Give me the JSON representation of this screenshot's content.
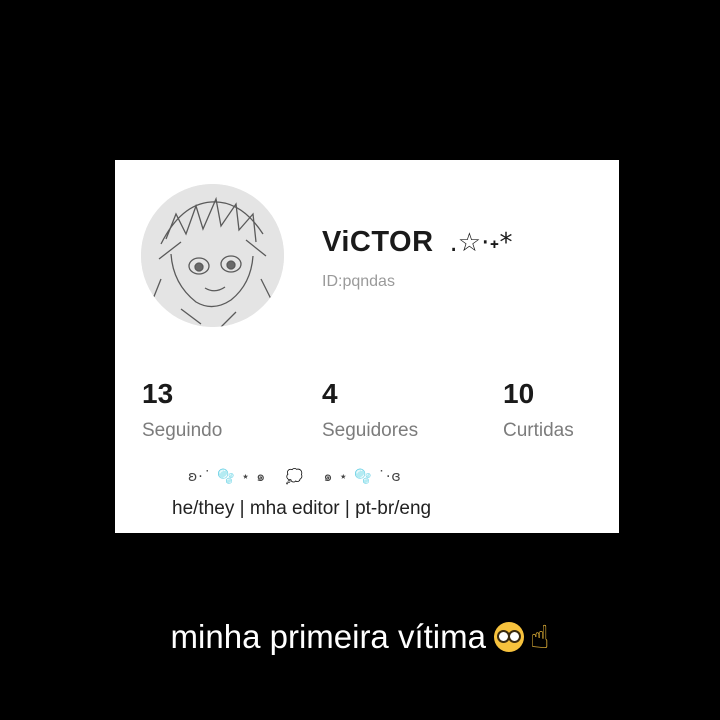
{
  "profile": {
    "name": "ViCTOR",
    "name_deco": ".☆·˖*",
    "id": "ID:pqndas"
  },
  "stats": [
    {
      "value": "13",
      "label": "Seguindo"
    },
    {
      "value": "4",
      "label": "Seguidores"
    },
    {
      "value": "10",
      "label": "Curtidas"
    }
  ],
  "bio": {
    "deco_left": "ʚ·˙ 🫧 ⋆ ๑",
    "deco_bubble": "💭",
    "deco_right": "๑ ⋆ 🫧 ˙·ɞ",
    "text": "he/they | mha editor | pt-br/eng"
  },
  "caption": {
    "text": "minha primeira vítima"
  },
  "icons": {
    "emoji_1": "nerd-face-icon",
    "emoji_2": "pointing-up-icon"
  }
}
